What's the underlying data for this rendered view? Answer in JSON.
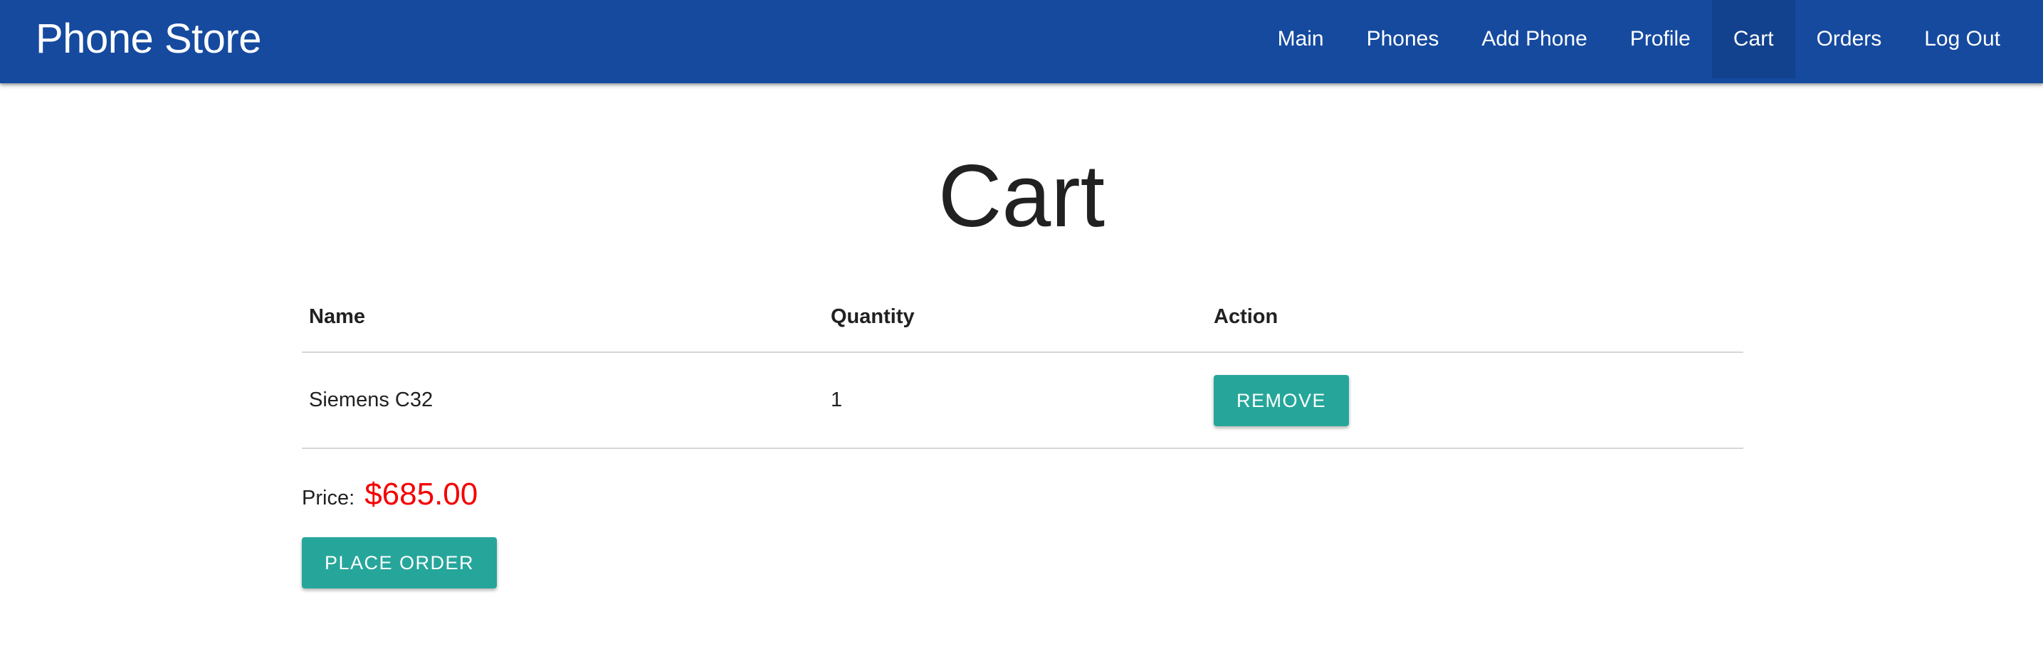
{
  "navbar": {
    "brand": "Phone Store",
    "items": [
      {
        "label": "Main"
      },
      {
        "label": "Phones"
      },
      {
        "label": "Add Phone"
      },
      {
        "label": "Profile"
      },
      {
        "label": "Cart",
        "active": true
      },
      {
        "label": "Orders"
      },
      {
        "label": "Log Out"
      }
    ],
    "background_color": "#154a9f",
    "active_color": "#12418d"
  },
  "page": {
    "title": "Cart"
  },
  "cart_table": {
    "headers": [
      "Name",
      "Quantity",
      "Action"
    ],
    "rows": [
      {
        "name": "Siemens C32",
        "quantity": "1",
        "action_label": "REMOVE"
      }
    ]
  },
  "summary": {
    "price_label": "Price:",
    "price_value": "$685.00",
    "price_color": "#f40000",
    "place_order_label": "PLACE ORDER",
    "button_color": "#26a69a"
  }
}
